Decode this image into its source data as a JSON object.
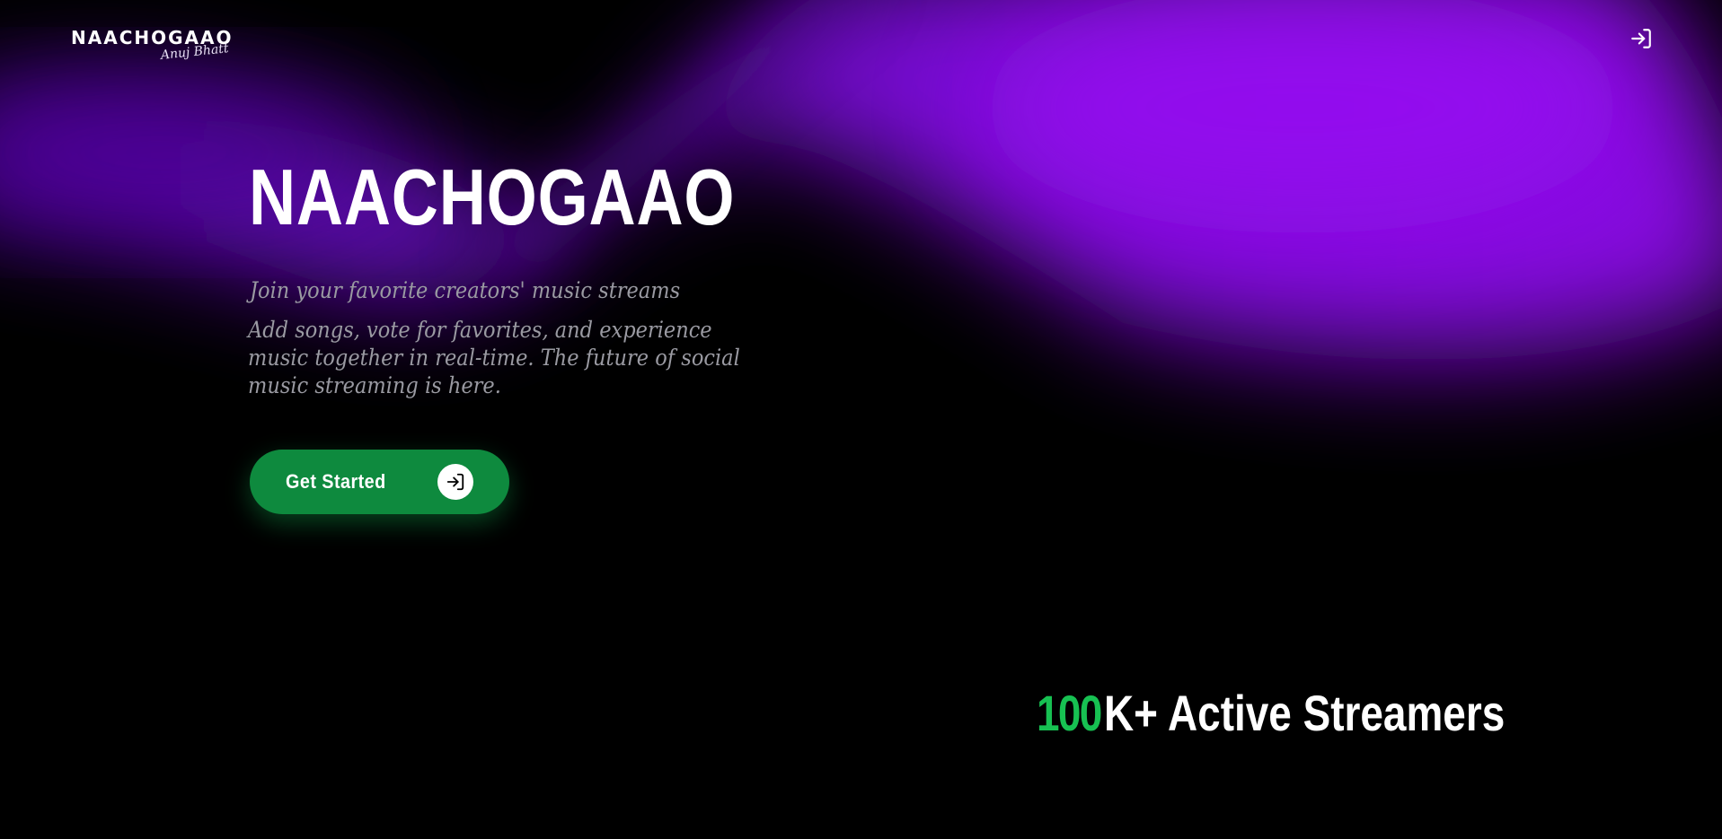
{
  "header": {
    "brand_name": "NAACHOGAAO",
    "brand_signature": "Anuj Bhatt",
    "login_icon": "sign-in-icon"
  },
  "hero": {
    "title": "NAACHOGAAO",
    "tagline": "Join your favorite creators' music streams",
    "description": "Add songs, vote for favorites, and experience music together in real-time. The future of social music streaming is here."
  },
  "cta": {
    "label": "Get Started",
    "icon": "sign-in-icon"
  },
  "stats": {
    "number": "100",
    "label": "K+ Active Streamers"
  },
  "colors": {
    "background": "#000000",
    "glow": "#8a0ae8",
    "cta_green": "#0e8a3e",
    "stat_green": "#17c152",
    "muted_text": "#9a9aa2"
  }
}
